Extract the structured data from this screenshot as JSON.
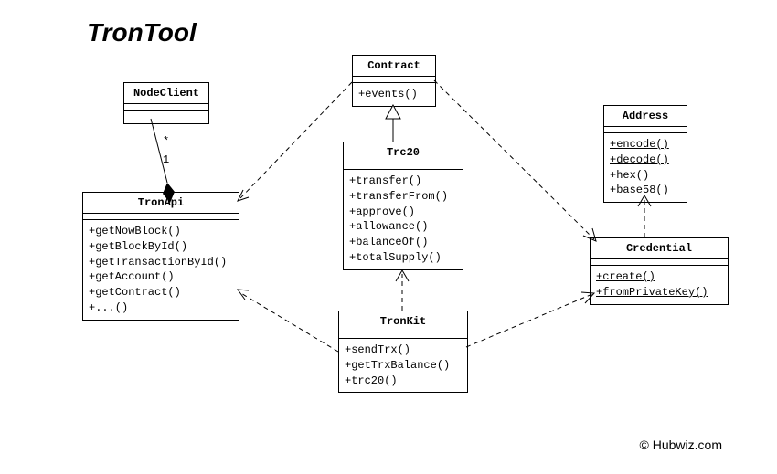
{
  "title": "TronTool",
  "credit": "© Hubwiz.com",
  "relations": {
    "node_tronapi": {
      "mult_parent": "*",
      "mult_child": "1"
    }
  },
  "classes": {
    "nodeclient": {
      "name": "NodeClient",
      "methods": []
    },
    "tronapi": {
      "name": "TronApi",
      "methods": [
        {
          "sig": "+getNowBlock()"
        },
        {
          "sig": "+getBlockById()"
        },
        {
          "sig": "+getTransactionById()"
        },
        {
          "sig": "+getAccount()"
        },
        {
          "sig": "+getContract()"
        },
        {
          "sig": "+...()"
        }
      ]
    },
    "contract": {
      "name": "Contract",
      "methods": [
        {
          "sig": "+events()"
        }
      ]
    },
    "trc20": {
      "name": "Trc20",
      "methods": [
        {
          "sig": "+transfer()"
        },
        {
          "sig": "+transferFrom()"
        },
        {
          "sig": "+approve()"
        },
        {
          "sig": "+allowance()"
        },
        {
          "sig": "+balanceOf()"
        },
        {
          "sig": "+totalSupply()"
        }
      ]
    },
    "tronkit": {
      "name": "TronKit",
      "methods": [
        {
          "sig": "+sendTrx()"
        },
        {
          "sig": "+getTrxBalance()"
        },
        {
          "sig": "+trc20()"
        }
      ]
    },
    "address": {
      "name": "Address",
      "methods": [
        {
          "sig": "+encode()",
          "static": true
        },
        {
          "sig": "+decode()",
          "static": true
        },
        {
          "sig": "+hex()"
        },
        {
          "sig": "+base58()"
        }
      ]
    },
    "credential": {
      "name": "Credential",
      "methods": [
        {
          "sig": "+create()",
          "static": true
        },
        {
          "sig": "+fromPrivateKey()",
          "static": true
        }
      ]
    }
  }
}
